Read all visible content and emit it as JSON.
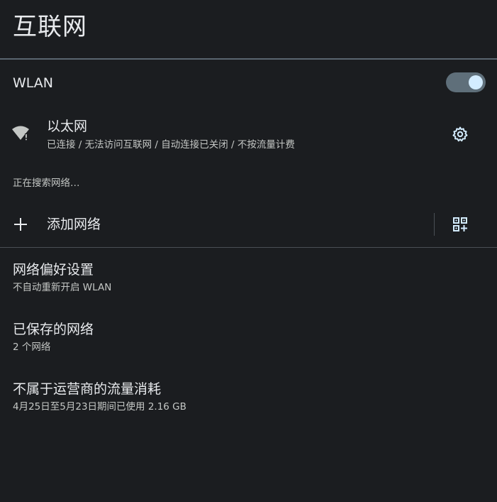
{
  "header": {
    "title": "互联网"
  },
  "wlan": {
    "label": "WLAN",
    "enabled": true
  },
  "ethernet": {
    "title": "以太网",
    "summary": "已连接 / 无法访问互联网 / 自动连接已关闭 / 不按流量计费",
    "icon": "wifi-icon"
  },
  "status": {
    "searching": "正在搜索网络…"
  },
  "add_network": {
    "label": "添加网络",
    "icons": [
      "plus-icon",
      "qr-code-scan-icon"
    ]
  },
  "preferences": {
    "items": [
      {
        "title": "网络偏好设置",
        "summary": "不自动重新开启 WLAN"
      },
      {
        "title": "已保存的网络",
        "summary": "2 个网络"
      },
      {
        "title": "不属于运营商的流量消耗",
        "summary": "4月25日至5月23日期间已使用 2.16 GB"
      }
    ]
  },
  "colors": {
    "background": "#1b1d20",
    "accent": "#d3ecff",
    "toggle_track": "#5f6f7a"
  }
}
